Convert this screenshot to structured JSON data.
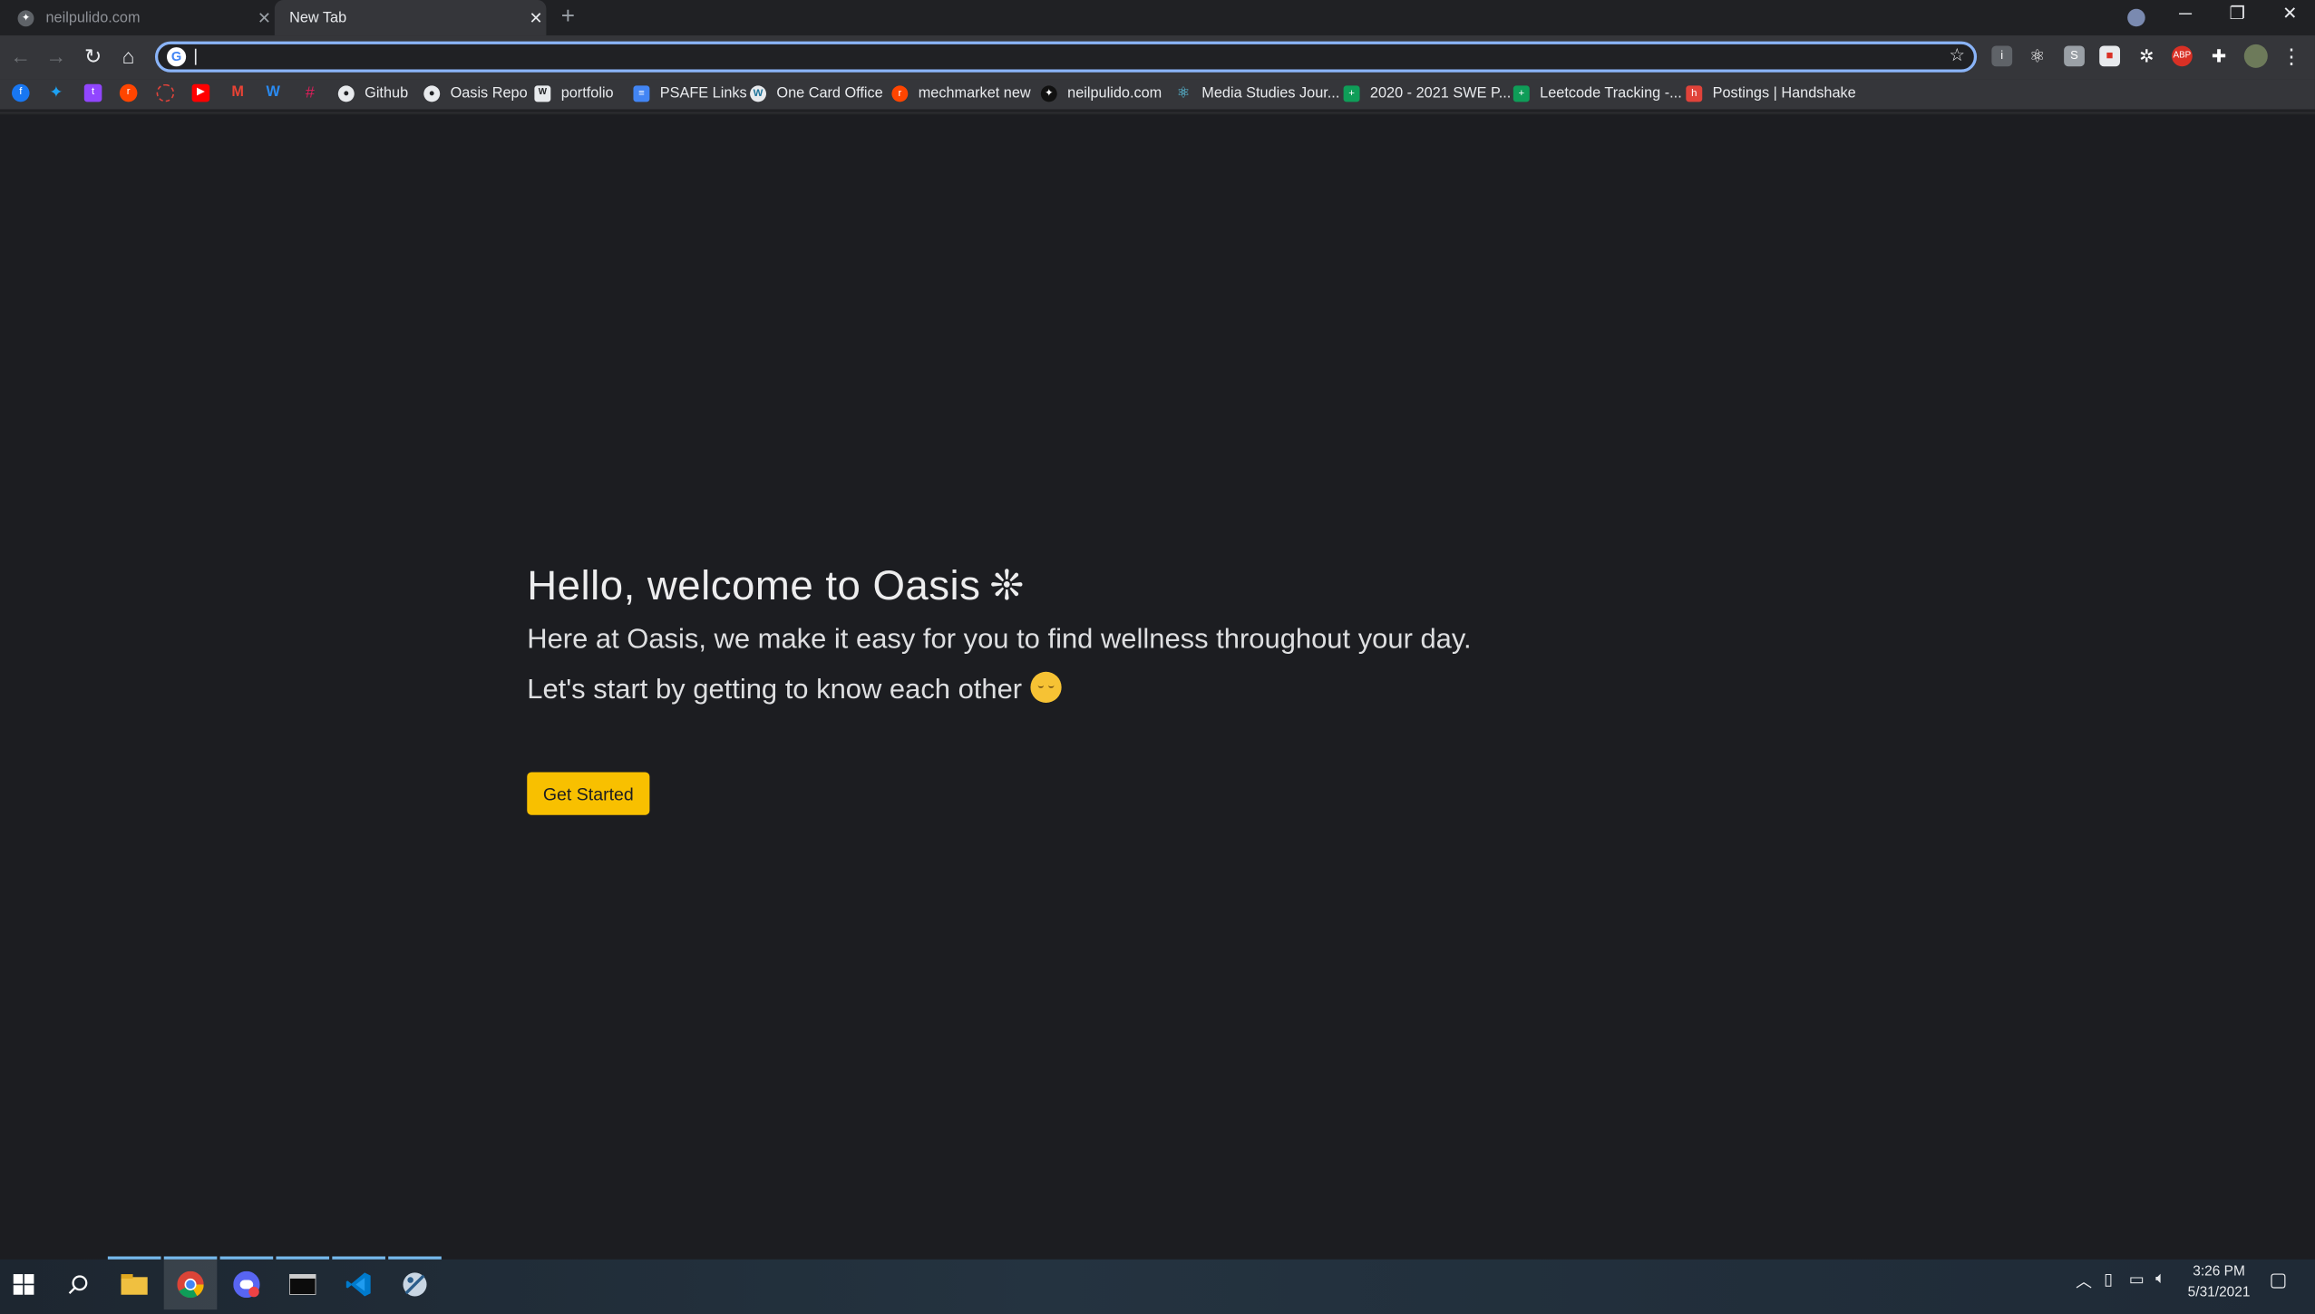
{
  "browser": {
    "tabs": [
      {
        "title": "neilpulido.com",
        "active": false
      },
      {
        "title": "New Tab",
        "active": true
      }
    ],
    "omnibox": {
      "value": "",
      "placeholder": ""
    },
    "bookmarks": [
      {
        "label": "Github",
        "icon": "github-icon"
      },
      {
        "label": "Oasis Repo",
        "icon": "github-icon"
      },
      {
        "label": "portfolio",
        "icon": "wix-icon"
      },
      {
        "label": "PSAFE Links",
        "icon": "docs-icon"
      },
      {
        "label": "One Card Office",
        "icon": "wordpress-icon"
      },
      {
        "label": "mechmarket new",
        "icon": "reddit-icon"
      },
      {
        "label": "neilpulido.com",
        "icon": "site-icon"
      },
      {
        "label": "Media Studies Jour...",
        "icon": "react-icon"
      },
      {
        "label": "2020 - 2021 SWE P...",
        "icon": "sheets-icon"
      },
      {
        "label": "Leetcode Tracking -...",
        "icon": "sheets-icon"
      },
      {
        "label": "Postings | Handshake",
        "icon": "handshake-icon"
      }
    ],
    "extension_abp_label": "ABP"
  },
  "page": {
    "heading": "Hello, welcome to Oasis",
    "heading_symbol": "❊",
    "line1": "Here at Oasis, we make it easy for you to find wellness throughout your day.",
    "line2": "Let's start by getting to know each other",
    "cta_label": "Get Started",
    "accent": "#f8c000",
    "background": "#1c1d21"
  },
  "taskbar": {
    "time": "3:26 PM",
    "date": "5/31/2021"
  }
}
